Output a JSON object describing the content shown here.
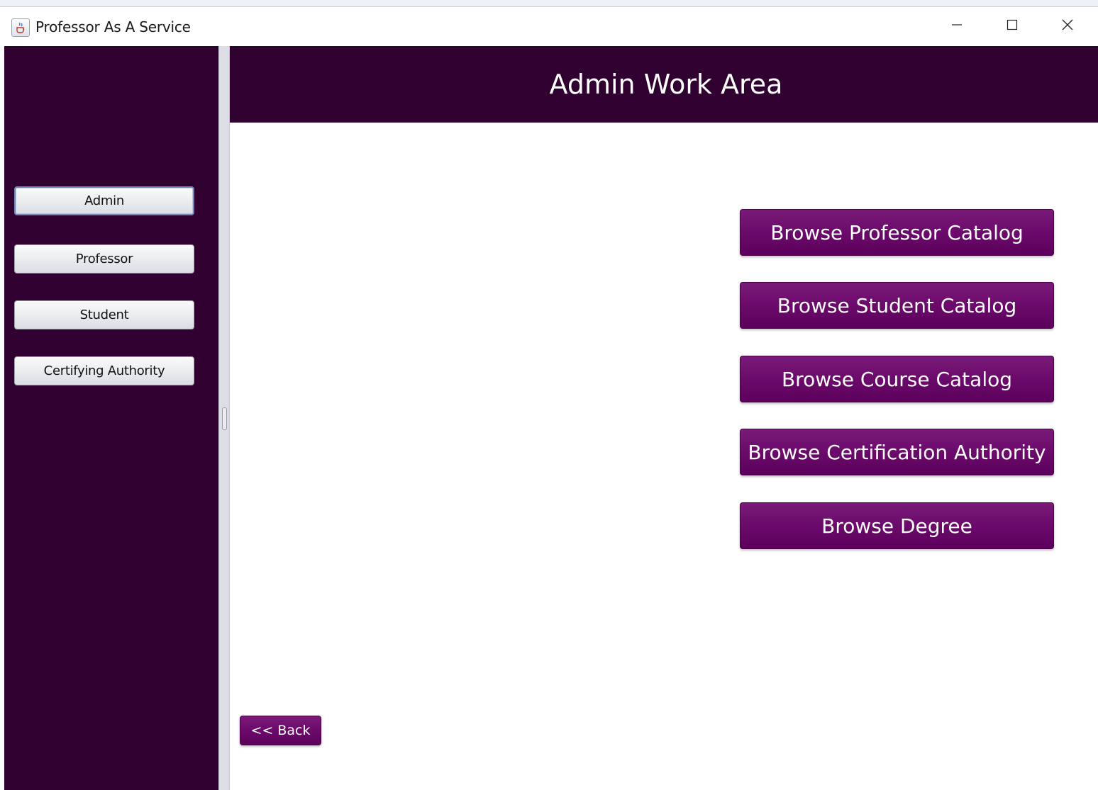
{
  "window": {
    "title": "Professor As A Service",
    "icon": "java-cup-icon",
    "controls": {
      "minimize_icon": "minimize-icon",
      "maximize_icon": "maximize-icon",
      "close_icon": "close-icon"
    }
  },
  "sidebar": {
    "background_color": "#300030",
    "items": [
      {
        "label": "Admin",
        "active": true
      },
      {
        "label": "Professor",
        "active": false
      },
      {
        "label": "Student",
        "active": false
      },
      {
        "label": "Certifying Authority",
        "active": false
      }
    ]
  },
  "main": {
    "header_title": "Admin Work Area",
    "header_color": "#300030",
    "button_color": "#6b0a6b",
    "actions": [
      "Browse Professor Catalog",
      "Browse Student Catalog",
      "Browse Course Catalog",
      "Browse Certification Authority",
      "Browse Degree"
    ],
    "back_label": "<< Back"
  }
}
